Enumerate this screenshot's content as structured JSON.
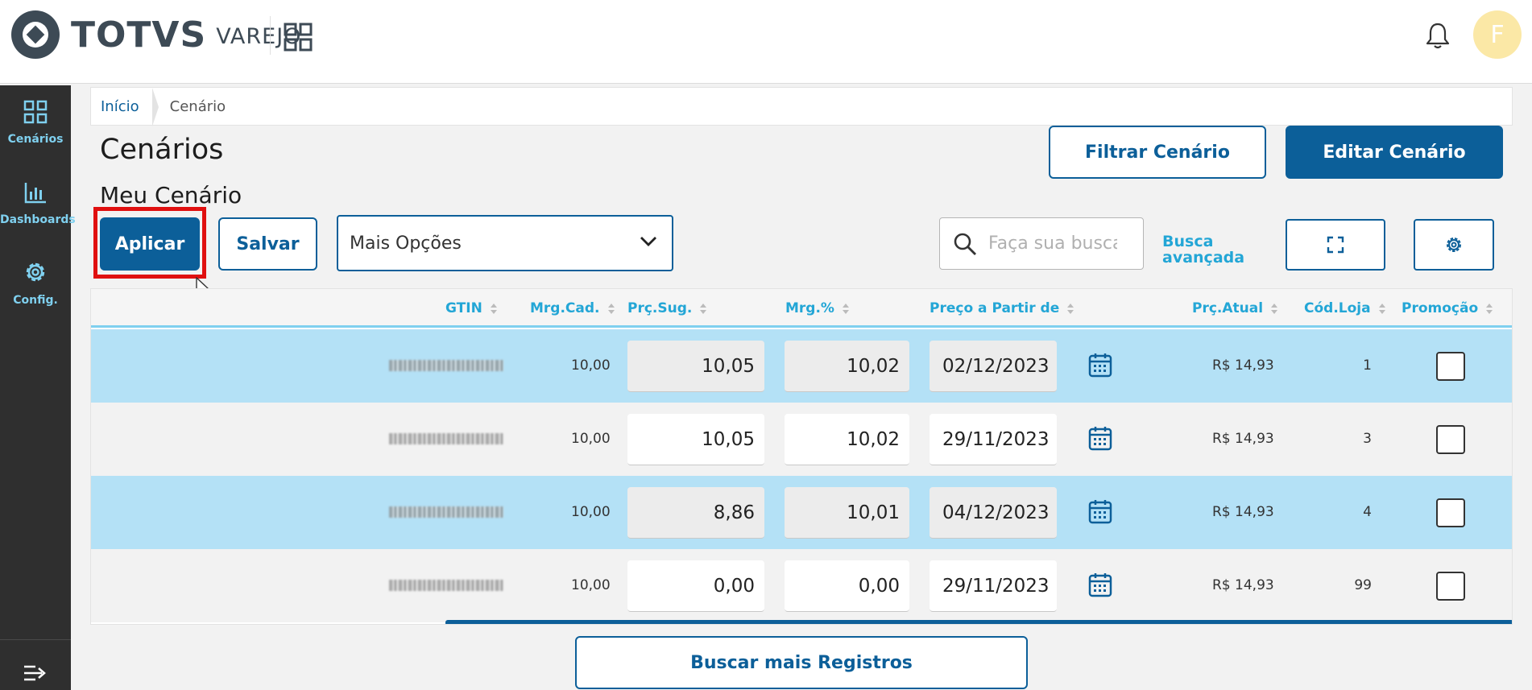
{
  "header": {
    "brand": "TOTVS",
    "brand_sub": "VAREJO",
    "avatar_letter": "F"
  },
  "sidebar": {
    "items": [
      {
        "label": "Cenários",
        "icon": "grid-icon"
      },
      {
        "label": "Dashboards",
        "icon": "bar-chart-icon"
      },
      {
        "label": "Config.",
        "icon": "gear-icon"
      }
    ],
    "collapse_icon": "collapse-menu-icon"
  },
  "breadcrumb": {
    "home": "Início",
    "current": "Cenário"
  },
  "page": {
    "title": "Cenários",
    "subtitle": "Meu Cenário"
  },
  "toolbar": {
    "filtrar_label": "Filtrar Cenário",
    "editar_label": "Editar Cenário",
    "aplicar_label": "Aplicar",
    "salvar_label": "Salvar",
    "mais_opcoes": "Mais Opções",
    "search_placeholder": "Faça sua busca",
    "busca_avancada_line1": "Busca",
    "busca_avancada_line2": "avançada",
    "more_records_label": "Buscar mais Registros"
  },
  "table": {
    "columns": [
      "GTIN",
      "Mrg.Cad.",
      "Prç.Sug.",
      "Mrg.%",
      "Preço a Partir de",
      "Prç.Atual",
      "Cód.Loja",
      "Promoção"
    ],
    "rows": [
      {
        "mrg_cad": "10,00",
        "prc_sug": "10,05",
        "mrg_pct": "10,02",
        "preco_partir": "02/12/2023",
        "prc_atual": "R$ 14,93",
        "cod_loja": "1"
      },
      {
        "mrg_cad": "10,00",
        "prc_sug": "10,05",
        "mrg_pct": "10,02",
        "preco_partir": "29/11/2023",
        "prc_atual": "R$ 14,93",
        "cod_loja": "3"
      },
      {
        "mrg_cad": "10,00",
        "prc_sug": "8,86",
        "mrg_pct": "10,01",
        "preco_partir": "04/12/2023",
        "prc_atual": "R$ 14,93",
        "cod_loja": "4"
      },
      {
        "mrg_cad": "10,00",
        "prc_sug": "0,00",
        "mrg_pct": "0,00",
        "preco_partir": "29/11/2023",
        "prc_atual": "R$ 14,93",
        "cod_loja": "99"
      }
    ]
  },
  "colors": {
    "primary": "#0c5f99",
    "accent": "#23a6d6",
    "row_highlight": "#b4e1f6",
    "sidebar_bg": "#2f2f2f",
    "focus_outline": "#e01010"
  }
}
